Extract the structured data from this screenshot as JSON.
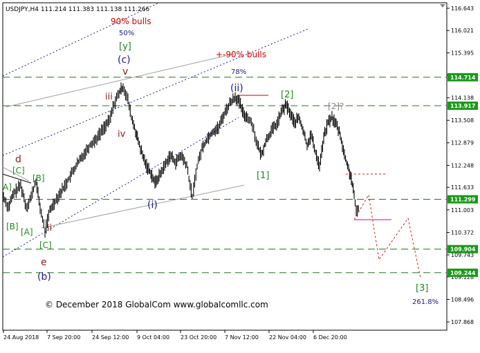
{
  "chart_data": {
    "type": "candlestick",
    "symbol": "USDJPY",
    "timeframe": "H4",
    "header": {
      "text": "USDJPY,H4  111.214 111.383 111.138 111.266"
    },
    "ylim": [
      107.868,
      116.643
    ],
    "y_ticks": [
      "116.643",
      "116.021",
      "115.395",
      "114.769",
      "114.138",
      "113.508",
      "112.879",
      "112.248",
      "111.633",
      "111.003",
      "110.372",
      "109.743",
      "109.128",
      "108.496",
      "107.868"
    ],
    "x_ticks": [
      "24 Aug 2018",
      "7 Sep 20:00",
      "24 Sep 12:00",
      "9 Oct 04:00",
      "23 Oct 20:00",
      "7 Nov 12:00",
      "22 Nov 04:00",
      "6 Dec 20:00"
    ],
    "price_tags": [
      {
        "label": "114.714",
        "value": 114.714,
        "color": "#1a9a1a"
      },
      {
        "label": "113.917",
        "value": 113.917,
        "color": "#1a9a1a"
      },
      {
        "label": "111.299",
        "value": 111.299,
        "color": "#1a9a1a"
      },
      {
        "label": "109.904",
        "value": 109.904,
        "color": "#1a9a1a"
      },
      {
        "label": "109.244",
        "value": 109.244,
        "color": "#1a9a1a"
      }
    ],
    "horizontal_levels": [
      114.714,
      113.917,
      111.299,
      109.904,
      109.244
    ],
    "wave_labels": [
      {
        "text": "90% bulls",
        "color": "#cc0000"
      },
      {
        "text": "50%",
        "color": "#1a1a80"
      },
      {
        "text": "[y]",
        "color": "#1a8a1a"
      },
      {
        "text": "(c)",
        "color": "#1a1a80"
      },
      {
        "text": "v",
        "color": "#8b1a1a"
      },
      {
        "text": "+-90% bulls",
        "color": "#cc0000"
      },
      {
        "text": "78%",
        "color": "#1a1a80"
      },
      {
        "text": "(ii)",
        "color": "#1a1a80"
      },
      {
        "text": "[2]",
        "color": "#1a8a1a"
      },
      {
        "text": "[2]?",
        "color": "#888888"
      },
      {
        "text": "iii",
        "color": "#8b1a1a"
      },
      {
        "text": "iv",
        "color": "#8b1a1a"
      },
      {
        "text": "d",
        "color": "#8b1a1a"
      },
      {
        "text": "[C]",
        "color": "#1a8a1a"
      },
      {
        "text": "[B]",
        "color": "#1a8a1a"
      },
      {
        "text": "A]",
        "color": "#1a8a1a"
      },
      {
        "text": "[B]",
        "color": "#1a8a1a"
      },
      {
        "text": "[A]",
        "color": "#1a8a1a"
      },
      {
        "text": "ii",
        "color": "#8b1a1a"
      },
      {
        "text": "[C]",
        "color": "#1a8a1a"
      },
      {
        "text": "e",
        "color": "#8b1a1a"
      },
      {
        "text": "(b)",
        "color": "#1a1a80"
      },
      {
        "text": "(i)",
        "color": "#1a1a80"
      },
      {
        "text": "[1]",
        "color": "#1a8a1a"
      },
      {
        "text": "[3]",
        "color": "#1a8a1a"
      },
      {
        "text": "261.8%",
        "color": "#1a1a80"
      }
    ],
    "copyright": "© December 2018 GlobalCom www.globalcomllc.com",
    "grid": false
  }
}
